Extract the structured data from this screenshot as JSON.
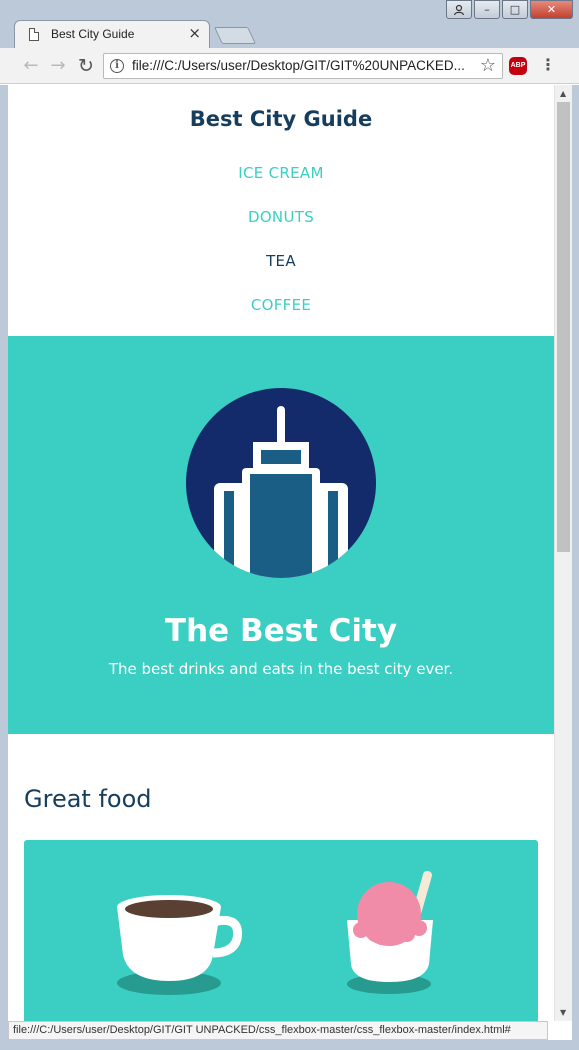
{
  "tab": {
    "title": "Best City Guide",
    "close": "×"
  },
  "window": {
    "minimize": "–",
    "maximize": "□",
    "close": "✕"
  },
  "toolbar": {
    "back": "←",
    "forward": "→",
    "reload": "↻",
    "url": "file:///C:/Users/user/Desktop/GIT/GIT%20UNPACKED...",
    "star": "☆",
    "abp": "ABP",
    "menu": "⋮"
  },
  "site": {
    "title": "Best City Guide",
    "nav": [
      {
        "label": "ICE CREAM",
        "active": false
      },
      {
        "label": "DONUTS",
        "active": false
      },
      {
        "label": "TEA",
        "active": true
      },
      {
        "label": "COFFEE",
        "active": false
      }
    ],
    "hero": {
      "title": "The Best City",
      "subtitle": "The best drinks and eats in the best city ever."
    },
    "section_title": "Great food"
  },
  "status_bar": "file:///C:/Users/user/Desktop/GIT/GIT UNPACKED/css_flexbox-master/css_flexbox-master/index.html#",
  "colors": {
    "teal": "#3bcfc4",
    "navy": "#163d5c",
    "link": "#3bcfc4",
    "link_active": "#163d5c",
    "circle": "#142b6b",
    "building": "#1a5e86"
  }
}
